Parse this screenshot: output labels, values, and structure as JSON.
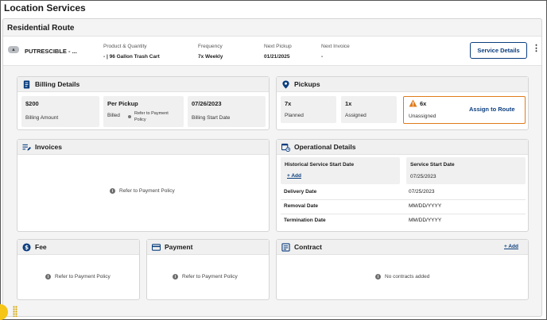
{
  "page": {
    "title": "Location Services"
  },
  "route": {
    "title": "Residential Route"
  },
  "summary": {
    "material": "PUTRESCIBLE - ...",
    "product_label": "Product & Quantity",
    "product_value": "- | 96 Gallon Trash Cart",
    "frequency_label": "Frequency",
    "frequency_value": "7x Weekly",
    "next_pickup_label": "Next Pickup",
    "next_pickup_value": "01/21/2025",
    "next_invoice_label": "Next Invoice",
    "next_invoice_value": "-",
    "service_details_button": "Service Details",
    "more_icon": "kebab-icon"
  },
  "billing": {
    "title": "Billing Details",
    "amount_value": "$200",
    "amount_label": "Billing Amount",
    "per_value": "Per Pickup",
    "billed_label": "Billed",
    "billed_note": "Refer to Payment Policy",
    "start_value": "07/26/2023",
    "start_label": "Billing Start Date"
  },
  "pickups": {
    "title": "Pickups",
    "planned_value": "7x",
    "planned_label": "Planned",
    "assigned_value": "1x",
    "assigned_label": "Assigned",
    "unassigned_value": "6x",
    "unassigned_label": "Unassigned",
    "assign_button": "Assign to Route",
    "warning_color": "#e07b1a"
  },
  "invoices": {
    "title": "Invoices",
    "message": "Refer to Payment Policy"
  },
  "operational": {
    "title": "Operational Details",
    "historical_label": "Historical Service Start Date",
    "historical_add": "+ Add",
    "service_start_label": "Service Start Date",
    "service_start_value": "07/25/2023",
    "delivery_label": "Delivery Date",
    "delivery_value": "07/25/2023",
    "removal_label": "Removal Date",
    "removal_value": "MM/DD/YYYY",
    "termination_label": "Termination Date",
    "termination_value": "MM/DD/YYYY"
  },
  "fee": {
    "title": "Fee",
    "message": "Refer to Payment Policy"
  },
  "payment": {
    "title": "Payment",
    "message": "Refer to Payment Policy"
  },
  "contract": {
    "title": "Contract",
    "add_link": "+ Add",
    "message": "No contracts added"
  },
  "colors": {
    "brand": "#0b3e7e",
    "panel_header": "#f0f0f0",
    "tile": "#f0f0f0"
  }
}
